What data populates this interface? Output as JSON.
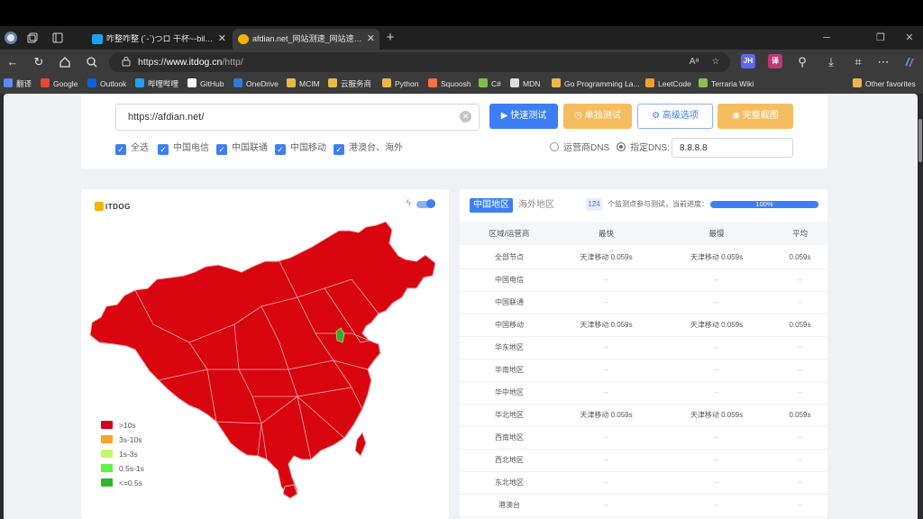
{
  "browser": {
    "tabs": [
      {
        "title": "咋整咋整 (´-`)つロ 干杯~-bilibili",
        "fav_color": "#1da1f2"
      },
      {
        "title": "afdian.net_网站测速_网站速度测试...",
        "fav_color": "#f1b400"
      }
    ],
    "url": {
      "scheme": "https://",
      "host": "www.itdog.cn",
      "path": "/http/"
    },
    "ext_labels": [
      "JH",
      "译"
    ],
    "bookmarks": [
      {
        "label": "翻译",
        "color": "#5a8cff"
      },
      {
        "label": "Google",
        "color": "#ea4335"
      },
      {
        "label": "Outlook",
        "color": "#0a64d8"
      },
      {
        "label": "哔哩哔哩",
        "color": "#1da1f2"
      },
      {
        "label": "GitHub",
        "color": "#ffffff"
      },
      {
        "label": "OneDrive",
        "color": "#2b7cd3"
      },
      {
        "label": "MCIM",
        "color": "#e8b84a"
      },
      {
        "label": "云服务商",
        "color": "#e8b84a"
      },
      {
        "label": "Python",
        "color": "#e8b84a"
      },
      {
        "label": "Squoosh",
        "color": "#ff6e40"
      },
      {
        "label": "C#",
        "color": "#7cc04a"
      },
      {
        "label": "MDN",
        "color": "#dddddd"
      },
      {
        "label": "Go Programming La...",
        "color": "#e8b84a"
      },
      {
        "label": "LeetCode",
        "color": "#f0a030"
      },
      {
        "label": "Terraria Wiki",
        "color": "#8cc056"
      },
      {
        "label": "Other favorites",
        "color": "#e8b84a"
      }
    ]
  },
  "form": {
    "input_value": "https://afdian.net/",
    "buttons": {
      "fast": "快速测试",
      "single": "单独测试",
      "advanced": "高级选项",
      "screenshot": "完整截图"
    },
    "checkboxes": [
      "全选",
      "中国电信",
      "中国联通",
      "中国移动",
      "港澳台、海外"
    ],
    "radios": {
      "isp_dns": "运营商DNS",
      "custom_dns": "指定DNS:"
    },
    "dns_value": "8.8.8.8"
  },
  "map": {
    "logo": "ITDOG",
    "legend": [
      {
        "label": ">10s",
        "color": "#d0021b"
      },
      {
        "label": "3s-10s",
        "color": "#f5a623"
      },
      {
        "label": "1s-3s",
        "color": "#c6f56b"
      },
      {
        "label": "0.5s-1s",
        "color": "#60f04a"
      },
      {
        "label": "<=0.5s",
        "color": "#2db82d"
      }
    ],
    "colors": {
      "region": "#d8050f",
      "border": "#f4b0b0",
      "highlight": "#3caa28"
    }
  },
  "results": {
    "tabs": [
      "中国地区",
      "海外地区"
    ],
    "node_count": "124",
    "progress_text": "个监测点参与测试，当前进度：",
    "progress_label": "100%",
    "progress_fraction": 1.0,
    "headers": [
      "区域/运营商",
      "最快",
      "最慢",
      "平均"
    ],
    "rows": [
      [
        "全部节点",
        "天津移动 0.059s",
        "天津移动 0.059s",
        "0.059s"
      ],
      [
        "中国电信",
        "--",
        "--",
        "--"
      ],
      [
        "中国联通",
        "--",
        "--",
        "--"
      ],
      [
        "中国移动",
        "天津移动 0.059s",
        "天津移动 0.059s",
        "0.059s"
      ],
      [
        "华东地区",
        "--",
        "--",
        "--"
      ],
      [
        "华南地区",
        "--",
        "--",
        "--"
      ],
      [
        "华中地区",
        "--",
        "--",
        "--"
      ],
      [
        "华北地区",
        "天津移动 0.059s",
        "天津移动 0.059s",
        "0.059s"
      ],
      [
        "西南地区",
        "--",
        "--",
        "--"
      ],
      [
        "西北地区",
        "--",
        "--",
        "--"
      ],
      [
        "东北地区",
        "--",
        "--",
        "--"
      ],
      [
        "港澳台",
        "--",
        "--",
        "--"
      ]
    ]
  }
}
